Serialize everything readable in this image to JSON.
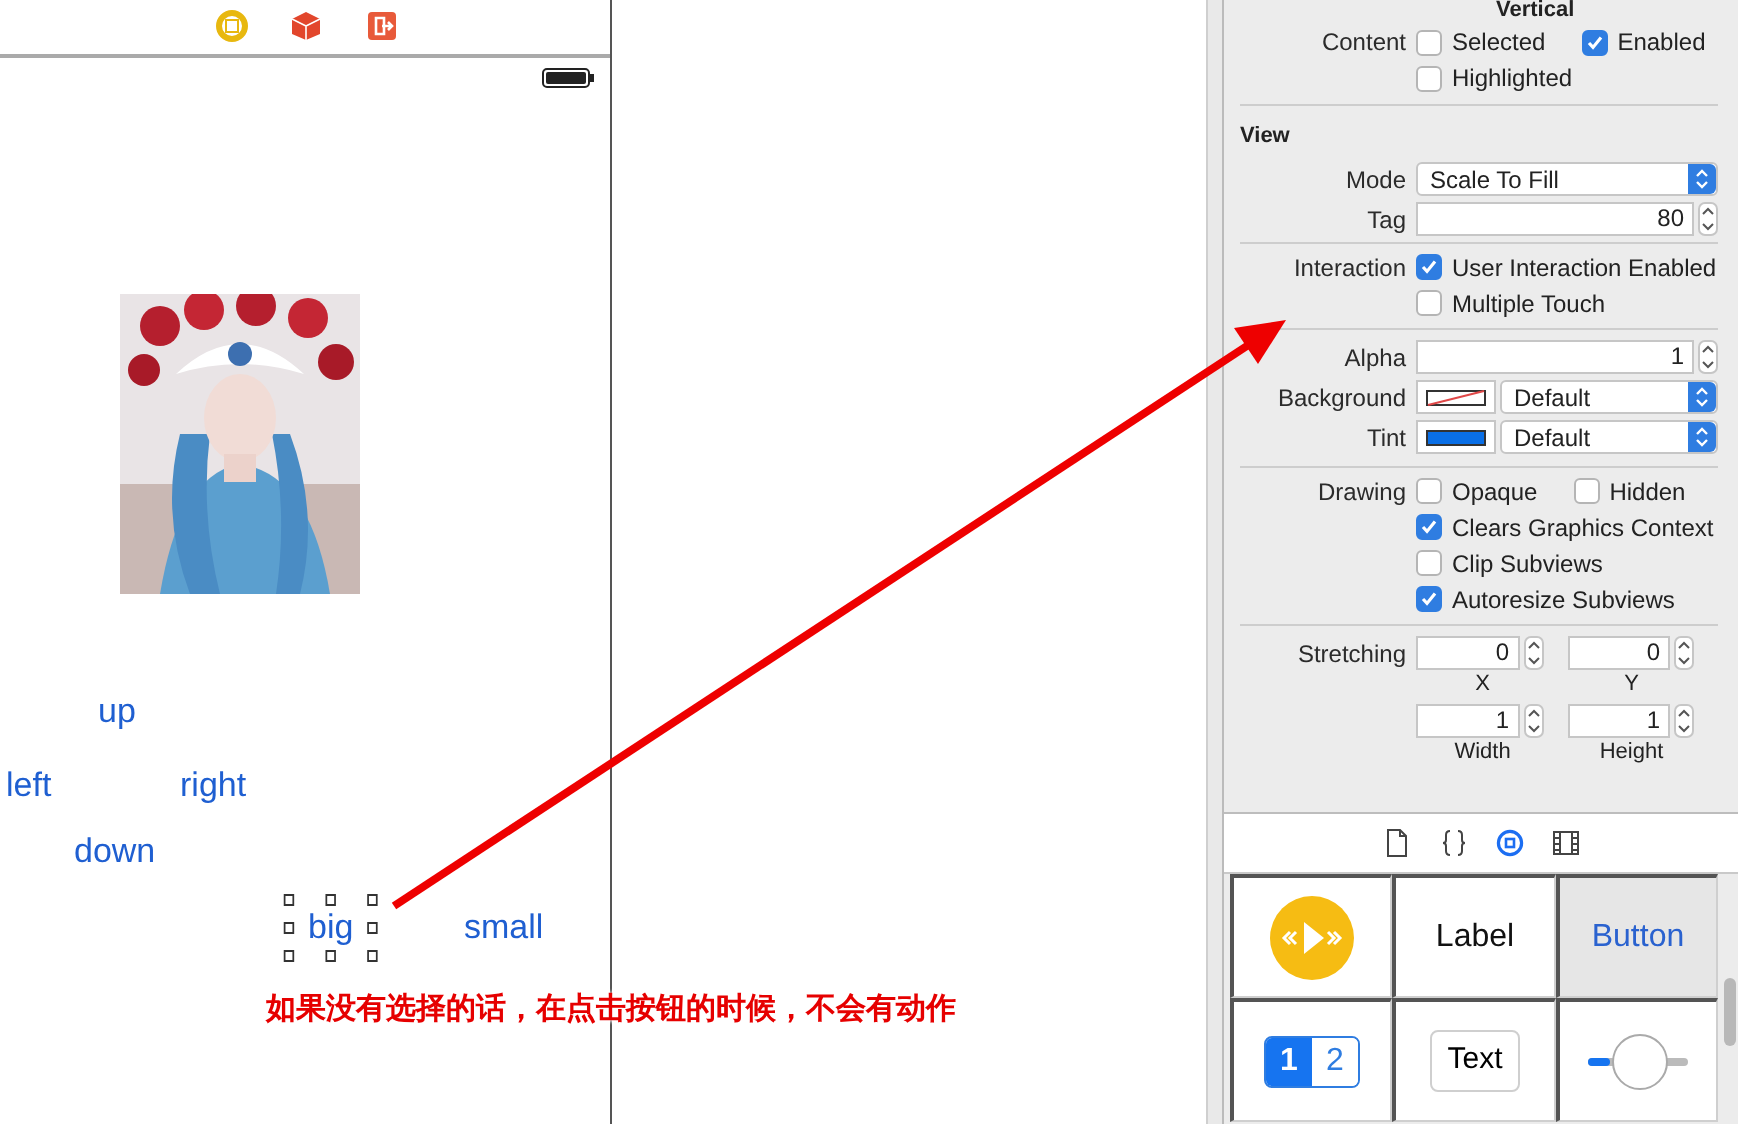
{
  "scene": {
    "buttons": [
      {
        "label": "up",
        "selected": false
      },
      {
        "label": "left",
        "selected": false
      },
      {
        "label": "right",
        "selected": false
      },
      {
        "label": "down",
        "selected": false
      },
      {
        "label": "big",
        "selected": true
      },
      {
        "label": "small",
        "selected": false
      }
    ]
  },
  "inspector": {
    "cut_heading": "Vertical",
    "content": {
      "label": "Content",
      "lines": [
        [
          {
            "label": "Selected",
            "checked": false
          },
          {
            "label": "Enabled",
            "checked": true
          }
        ],
        [
          {
            "label": "Highlighted",
            "checked": false
          }
        ]
      ]
    },
    "view": {
      "title": "View",
      "groups": [
        [
          {
            "kind": "popup",
            "label": "Mode",
            "value": "Scale To Fill"
          },
          {
            "kind": "number",
            "label": "Tag",
            "value": "80"
          }
        ],
        [
          {
            "kind": "checks",
            "label": "Interaction",
            "lines": [
              [
                {
                  "label": "User Interaction Enabled",
                  "checked": true
                }
              ],
              [
                {
                  "label": "Multiple Touch",
                  "checked": false
                }
              ]
            ]
          }
        ],
        [
          {
            "kind": "number",
            "label": "Alpha",
            "value": "1"
          },
          {
            "kind": "color",
            "label": "Background",
            "clear": true,
            "value": "Default"
          },
          {
            "kind": "color",
            "label": "Tint",
            "clear": false,
            "color": "#0a6fe6",
            "value": "Default"
          }
        ],
        [
          {
            "kind": "checks",
            "label": "Drawing",
            "lines": [
              [
                {
                  "label": "Opaque",
                  "checked": false
                },
                {
                  "label": "Hidden",
                  "checked": false
                }
              ],
              [
                {
                  "label": "Clears Graphics Context",
                  "checked": true
                }
              ],
              [
                {
                  "label": "Clip Subviews",
                  "checked": false
                }
              ],
              [
                {
                  "label": "Autoresize Subviews",
                  "checked": true
                }
              ]
            ]
          }
        ],
        [
          {
            "kind": "fields",
            "label": "Stretching",
            "lines": [
              [
                {
                  "value": "0",
                  "caption": "X"
                },
                {
                  "value": "0",
                  "caption": "Y"
                }
              ],
              [
                {
                  "value": "1",
                  "caption": "Width"
                },
                {
                  "value": "1",
                  "caption": "Height"
                }
              ]
            ]
          }
        ]
      ]
    }
  },
  "library": {
    "tabs": [
      {
        "selected": false
      },
      {
        "selected": false
      },
      {
        "selected": true
      },
      {
        "selected": false
      }
    ],
    "items": [
      {
        "kind": "media",
        "selected": false
      },
      {
        "kind": "label",
        "text": "Label",
        "selected": false
      },
      {
        "kind": "button",
        "text": "Button",
        "selected": true
      },
      {
        "kind": "segmented",
        "selected": false,
        "segments": [
          {
            "label": "1",
            "selected": true
          },
          {
            "label": "2",
            "selected": false
          }
        ]
      },
      {
        "kind": "textfield",
        "text": "Text",
        "selected": false
      },
      {
        "kind": "slider",
        "level": 0.22,
        "selected": false
      }
    ]
  },
  "annotation": {
    "text": "如果没有选择的话，在点击按钮的时候，不会有动作"
  }
}
